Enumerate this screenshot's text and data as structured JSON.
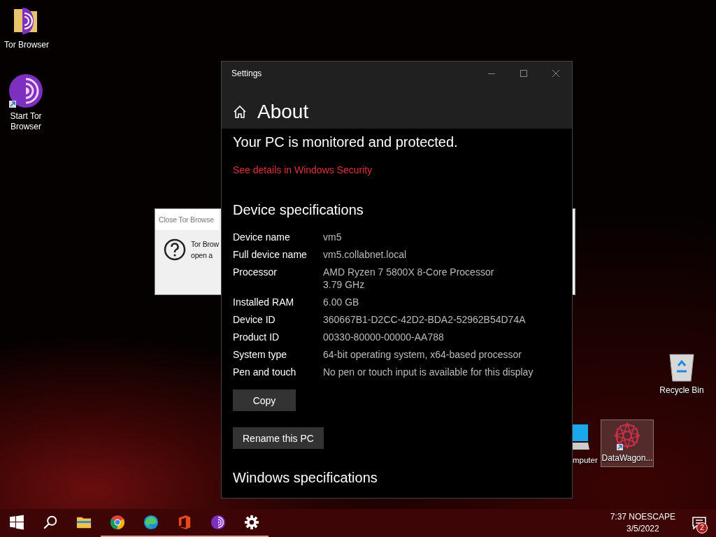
{
  "desktop_icons": [
    {
      "kind": "tor-folder",
      "label": "Tor Browser",
      "selected": false
    },
    {
      "kind": "tor-app",
      "label": "Start Tor Browser",
      "selected": false
    },
    {
      "kind": "recycle-bin",
      "label": "Recycle Bin",
      "selected": false
    },
    {
      "kind": "computer",
      "label": "mputer",
      "selected": false
    },
    {
      "kind": "app-shortcut",
      "label": "DataWagon...",
      "selected": true
    }
  ],
  "dialog": {
    "title": "Close Tor Browse",
    "body_lines": [
      "Tor Brow",
      "open a"
    ]
  },
  "settings": {
    "window_title": "Settings",
    "page_title": "About",
    "status": "Your PC is monitored and protected.",
    "link": "See details in Windows Security",
    "section": "Device specifications",
    "specs": [
      {
        "label": "Device name",
        "values": [
          "vm5"
        ]
      },
      {
        "label": "Full device name",
        "values": [
          "vm5.collabnet.local"
        ]
      },
      {
        "label": "Processor",
        "values": [
          "AMD Ryzen 7 5800X 8-Core Processor",
          "3.79 GHz"
        ]
      },
      {
        "label": "Installed RAM",
        "values": [
          "6.00 GB"
        ]
      },
      {
        "label": "Device ID",
        "values": [
          "360667B1-D2CC-42D2-BDA2-52962B54D74A"
        ]
      },
      {
        "label": "Product ID",
        "values": [
          "00330-80000-00000-AA788"
        ]
      },
      {
        "label": "System type",
        "values": [
          "64-bit operating system, x64-based processor"
        ]
      },
      {
        "label": "Pen and touch",
        "values": [
          "No pen or touch input is available for this display"
        ]
      }
    ],
    "buttons": [
      "Copy",
      "Rename this PC"
    ],
    "next_section": "Windows specifications"
  },
  "taskbar": {
    "items": [
      {
        "kind": "start",
        "running": false
      },
      {
        "kind": "search",
        "running": false
      },
      {
        "kind": "explorer",
        "running": false
      },
      {
        "kind": "chrome",
        "running": true
      },
      {
        "kind": "edge",
        "running": true
      },
      {
        "kind": "office",
        "running": true
      },
      {
        "kind": "tor",
        "running": true
      },
      {
        "kind": "settings",
        "running": true
      }
    ],
    "time": "7:37 NOESCAPE",
    "date": "3/5/2022",
    "notification_count": "2"
  }
}
